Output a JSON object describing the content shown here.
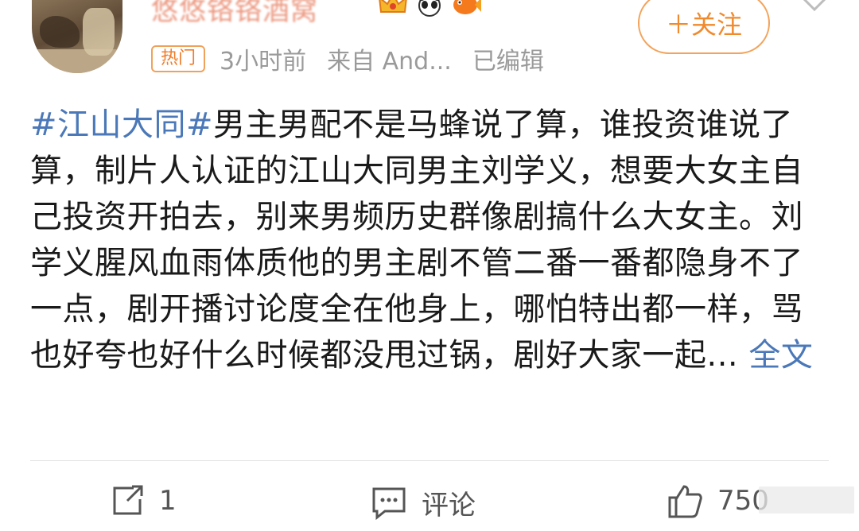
{
  "user": {
    "name": "悠悠铬铬酒窝",
    "badges": [
      "crown-badge-icon",
      "panda-badge-icon",
      "fish-badge-icon"
    ]
  },
  "follow_label": "＋关注",
  "meta": {
    "hot_tag": "热门",
    "time": "3小时前",
    "source": "来自 And...",
    "edited": "已编辑"
  },
  "post": {
    "hashtag": "#江山大同#",
    "body": "男主男配不是马蜂说了算，谁投资谁说了算，制片人认证的江山大同男主刘学义，想要大女主自己投资开拍去，别来男频历史群像剧搞什么大女主。刘学义腥风血雨体质他的男主剧不管二番一番都隐身不了一点，剧开播讨论度全在他身上，哪怕特出都一样，骂也好夸也好什么时候都没甩过锅，剧好大家一起...",
    "expand_label": "全文"
  },
  "actions": {
    "repost_count": "1",
    "comment_label": "评论",
    "like_count": "750"
  },
  "colors": {
    "hashtag": "#4a78b8",
    "follow": "#f18a2c",
    "meta": "#9a9a9a"
  }
}
